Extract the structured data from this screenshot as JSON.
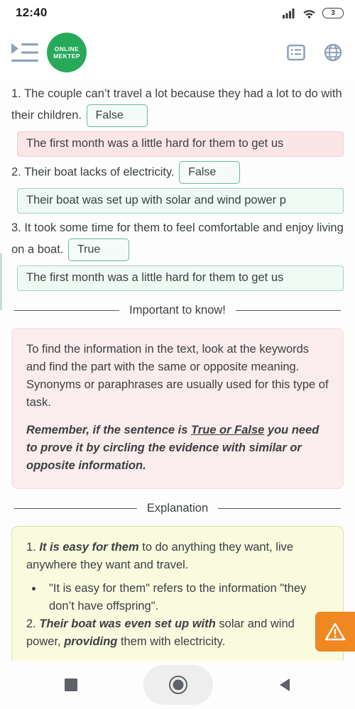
{
  "status_bar": {
    "time": "12:40",
    "signal_icon": "cellular-signal-icon",
    "wifi_icon": "wifi-icon",
    "battery_level": "3"
  },
  "app_bar": {
    "menu_icon": "indent-menu-icon",
    "logo_line1": "ONLINE",
    "logo_line2": "MEKTEP",
    "list_icon": "list-view-icon",
    "language_icon": "globe-icon"
  },
  "questions": [
    {
      "number": "1.",
      "text_before": "The couple can’t travel a lot because they had a lot to do with their children.",
      "answer": "False",
      "evidence": "The first month was a little hard for them to get us",
      "state": "wrong"
    },
    {
      "number": "2.",
      "text_before": "Their boat lacks of electricity.",
      "answer": "False",
      "evidence": "Their boat was set up with solar and wind power p",
      "state": "right"
    },
    {
      "number": "3.",
      "text_before": "It took some time for them to feel comfortable and enjoy living on a boat.",
      "answer": "True",
      "evidence": "The first month was a little hard for them to get us",
      "state": "right"
    }
  ],
  "important_section": {
    "divider_title": "Important to know!",
    "paragraph1": "To find the information in the text, look at the keywords and find the part with the same or opposite meaning. Synonyms or paraphrases are usually used for this type of task.",
    "paragraph2_part1": "Remember, if the sentence is ",
    "paragraph2_underlined": "True or False",
    "paragraph2_part2": " you need to prove it by circling the evidence with similar or opposite information."
  },
  "explanation_section": {
    "divider_title": "Explanation",
    "item1_number": "1.",
    "item1_bold": "It is easy for them",
    "item1_rest": " to do anything they want, live anywhere they want and travel.",
    "item1_bullet": "\"It is easy for them\" refers to the information \"they don’t have offspring\".",
    "item2_number": "2.",
    "item2_bold1": "Their boat was even set up with",
    "item2_mid": " solar and wind power, ",
    "item2_bold2": "providing",
    "item2_rest": " them with electricity."
  },
  "report_button": {
    "icon": "warning-triangle-icon"
  },
  "nav_bar": {
    "recents_icon": "recents-square-icon",
    "home_icon": "home-circle-icon",
    "back_icon": "back-triangle-icon"
  },
  "colors": {
    "brand_green": "#27a95a",
    "correct_green": "#9fd3c2",
    "wrong_pink": "#f4cdd2",
    "report_orange": "#f08721",
    "icon_slate": "#8fa3b8"
  }
}
